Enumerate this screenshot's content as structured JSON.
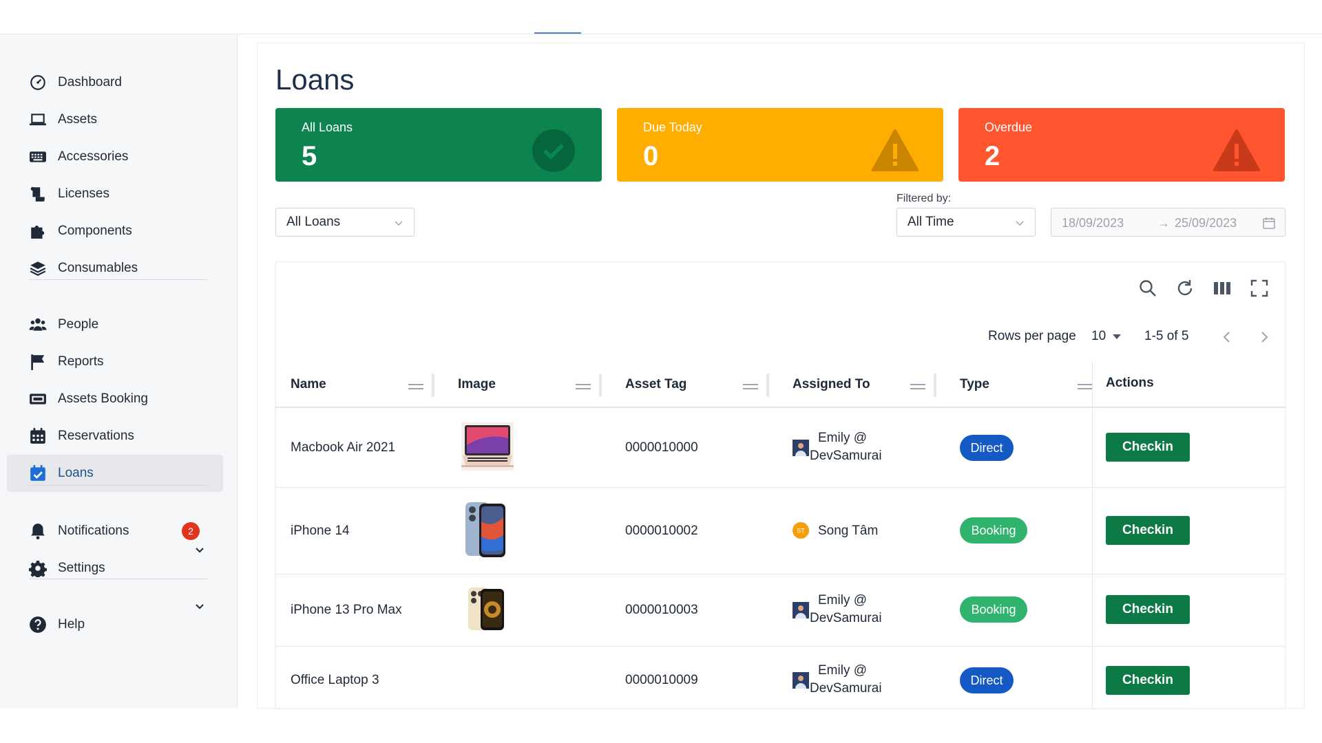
{
  "sidebar": {
    "items": [
      {
        "label": "Dashboard",
        "icon": "dashboard-icon"
      },
      {
        "label": "Assets",
        "icon": "laptop-icon"
      },
      {
        "label": "Accessories",
        "icon": "keyboard-icon"
      },
      {
        "label": "Licenses",
        "icon": "license-icon"
      },
      {
        "label": "Components",
        "icon": "puzzle-icon"
      },
      {
        "label": "Consumables",
        "icon": "layers-icon"
      },
      {
        "label": "People",
        "icon": "people-icon"
      },
      {
        "label": "Reports",
        "icon": "flag-icon"
      },
      {
        "label": "Assets Booking",
        "icon": "booking-icon"
      },
      {
        "label": "Reservations",
        "icon": "calendar-icon"
      },
      {
        "label": "Loans",
        "icon": "calendar-check-icon"
      },
      {
        "label": "Notifications",
        "icon": "bell-icon",
        "badge": "2"
      },
      {
        "label": "Settings",
        "icon": "gear-icon"
      },
      {
        "label": "Help",
        "icon": "help-icon"
      }
    ],
    "active": "Loans"
  },
  "page": {
    "title": "Loans"
  },
  "stats": [
    {
      "label": "All Loans",
      "value": "5",
      "color": "#0d8450"
    },
    {
      "label": "Due Today",
      "value": "0",
      "color": "#ffad00"
    },
    {
      "label": "Overdue",
      "value": "2",
      "color": "#ff5630"
    }
  ],
  "filters": {
    "loan_type": "All Loans",
    "filtered_by_label": "Filtered by:",
    "time": "All Time",
    "date_from": "18/09/2023",
    "date_to": "25/09/2023",
    "arrow": "→"
  },
  "pagination": {
    "rows_label": "Rows per page",
    "rows_value": "10",
    "range": "1-5 of 5"
  },
  "table": {
    "columns": [
      "Name",
      "Image",
      "Asset Tag",
      "Assigned To",
      "Type",
      "Actions"
    ],
    "rows": [
      {
        "name": "Macbook Air 2021",
        "tag": "0000010000",
        "assigned_line1": "Emily @",
        "assigned_line2": "DevSamurai",
        "type": "Direct",
        "action": "Checkin"
      },
      {
        "name": "iPhone 14",
        "tag": "0000010002",
        "assigned_line1": "Song Tâm",
        "assigned_line2": "",
        "type": "Booking",
        "action": "Checkin",
        "avatar_initials": "ST"
      },
      {
        "name": "iPhone 13 Pro Max",
        "tag": "0000010003",
        "assigned_line1": "Emily @",
        "assigned_line2": "DevSamurai",
        "type": "Booking",
        "action": "Checkin"
      },
      {
        "name": "Office Laptop 3",
        "tag": "0000010009",
        "assigned_line1": "Emily @",
        "assigned_line2": "DevSamurai",
        "type": "Direct",
        "action": "Checkin"
      }
    ]
  }
}
